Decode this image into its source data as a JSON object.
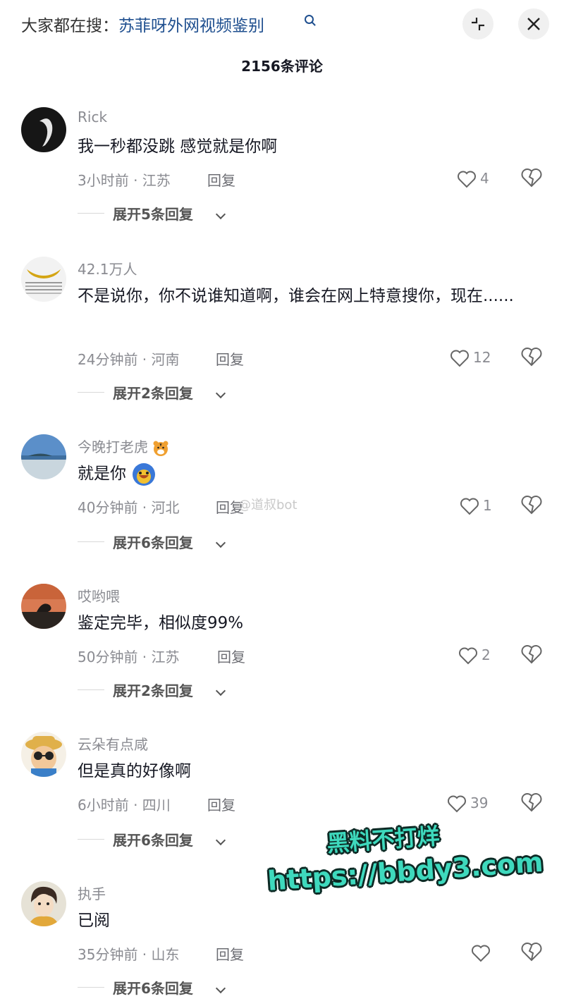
{
  "header": {
    "search_prefix": "大家都在搜：",
    "search_query": "苏菲呀外网视频鉴别",
    "comment_count_title": "2156条评论"
  },
  "comments": [
    {
      "username": "Rick",
      "content": "我一秒都没跳 感觉就是你啊",
      "time_location": "3小时前 · 江苏",
      "reply": "回复",
      "likes": "4",
      "expand": "展开5条回复"
    },
    {
      "username": "42.1万人",
      "content": "不是说你，你不说谁知道啊，谁会在网上特意搜你，现在......",
      "time_location": "24分钟前 · 河南",
      "reply": "回复",
      "likes": "12",
      "expand": "展开2条回复"
    },
    {
      "username": "今晚打老虎",
      "content": "就是你",
      "time_location": "40分钟前 · 河北",
      "reply": "回复",
      "likes": "1",
      "expand": "展开6条回复"
    },
    {
      "username": "哎哟喂",
      "content": "鉴定完毕，相似度99%",
      "time_location": "50分钟前 · 江苏",
      "reply": "回复",
      "likes": "2",
      "expand": "展开2条回复"
    },
    {
      "username": "云朵有点咸",
      "content": "但是真的好像啊",
      "time_location": "6小时前 · 四川",
      "reply": "回复",
      "likes": "39",
      "expand": "展开6条回复"
    },
    {
      "username": "执手",
      "content": "已阅",
      "time_location": "35分钟前 · 山东",
      "reply": "回复",
      "likes": "",
      "expand": "展开6条回复"
    }
  ],
  "watermarks": {
    "weibo": "@道叔bot",
    "promo_line1": "黑料不打烊",
    "promo_line2": "https://bbdy3.com"
  },
  "icons": {
    "header": [
      "collapse-icon",
      "close-icon",
      "search-icon"
    ],
    "per_comment": [
      "heart-icon",
      "broken-heart-icon",
      "chevron-down-icon"
    ]
  }
}
